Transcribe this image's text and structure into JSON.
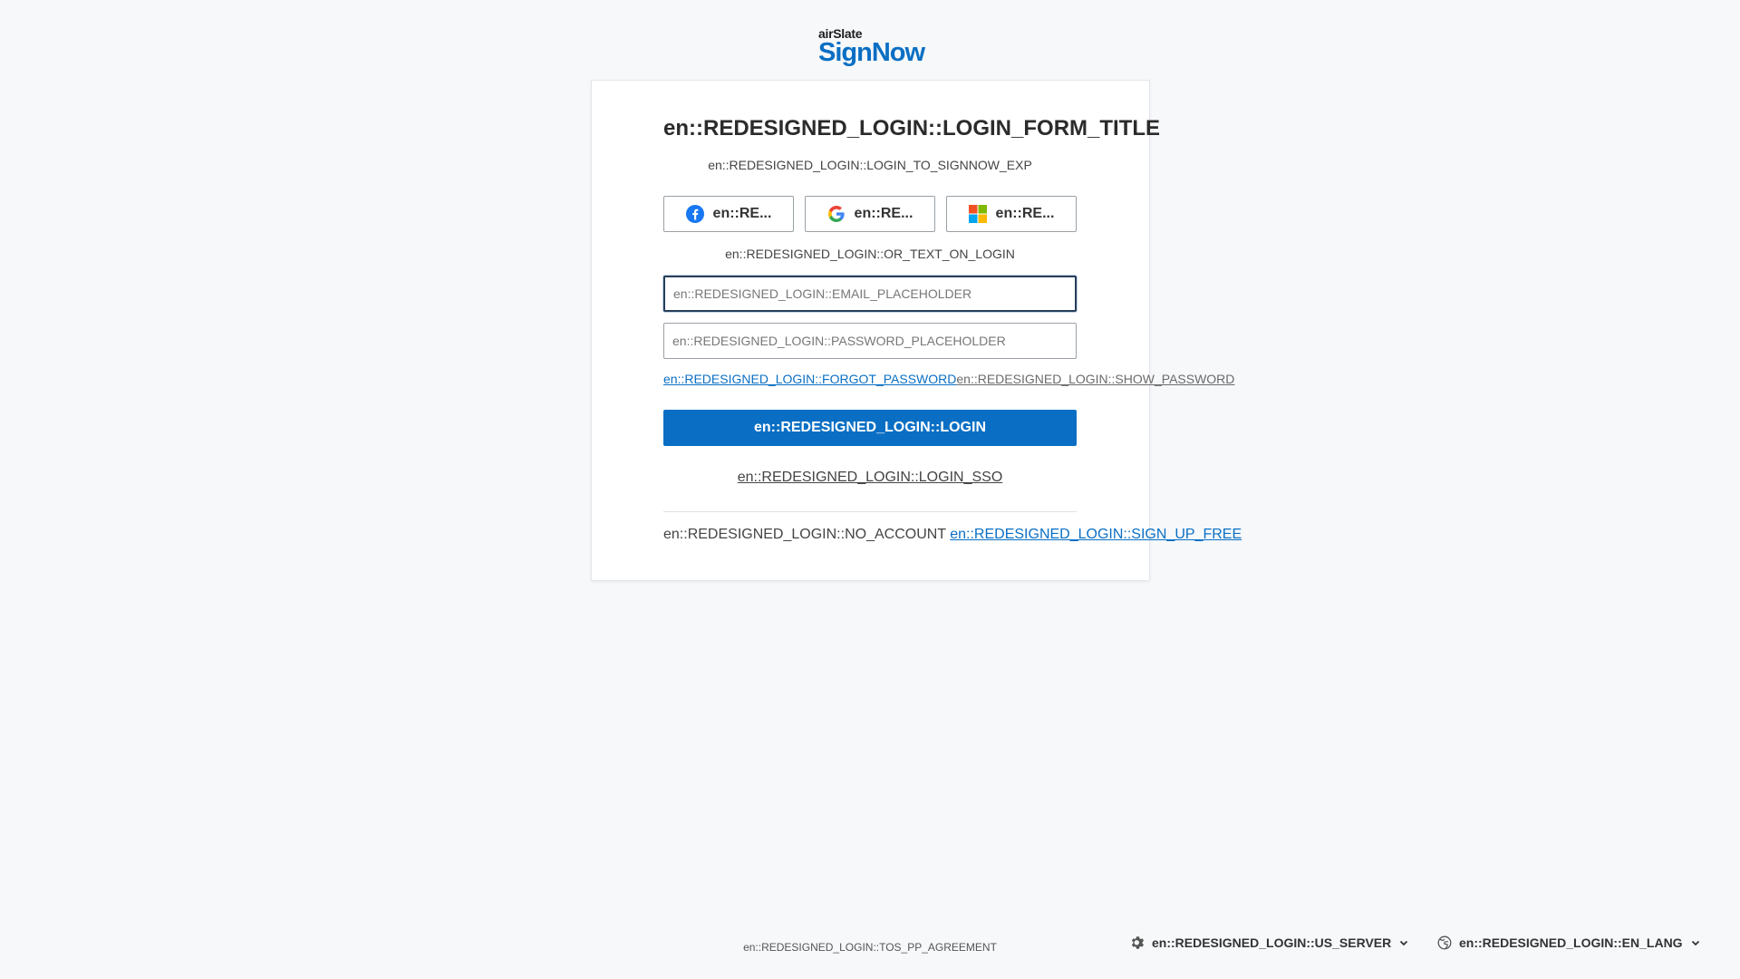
{
  "logo": {
    "top": "airSlate",
    "main": "SignNow"
  },
  "login_form": {
    "title": "en::REDESIGNED_LOGIN::LOGIN_FORM_TITLE",
    "subtitle": "en::REDESIGNED_LOGIN::LOGIN_TO_SIGNNOW_EXP",
    "social_buttons": [
      {
        "label": "en::RE...",
        "icon": "facebook-icon"
      },
      {
        "label": "en::RE...",
        "icon": "google-icon"
      },
      {
        "label": "en::RE...",
        "icon": "microsoft-icon"
      }
    ],
    "or_text": "en::REDESIGNED_LOGIN::OR_TEXT_ON_LOGIN",
    "email_placeholder": "en::REDESIGNED_LOGIN::EMAIL_PLACEHOLDER",
    "email_value": "",
    "password_placeholder": "en::REDESIGNED_LOGIN::PASSWORD_PLACEHOLDER",
    "password_value": "",
    "forgot_password": "en::REDESIGNED_LOGIN::FORGOT_PASSWORD",
    "show_password": "en::REDESIGNED_LOGIN::SHOW_PASSWORD",
    "login_button": "en::REDESIGNED_LOGIN::LOGIN",
    "login_sso": "en::REDESIGNED_LOGIN::LOGIN_SSO",
    "no_account": "en::REDESIGNED_LOGIN::NO_ACCOUNT",
    "sign_up": "en::REDESIGNED_LOGIN::SIGN_UP_FREE"
  },
  "footer": {
    "tos": "en::REDESIGNED_LOGIN::TOS_PP_AGREEMENT",
    "server": {
      "label": "en::REDESIGNED_LOGIN::US_SERVER",
      "icon": "gear-icon"
    },
    "language": {
      "label": "en::REDESIGNED_LOGIN::EN_LANG",
      "icon": "globe-icon"
    }
  },
  "colors": {
    "background": "#f6f8fa",
    "accent": "#0a6fc4",
    "card": "#ffffff"
  }
}
